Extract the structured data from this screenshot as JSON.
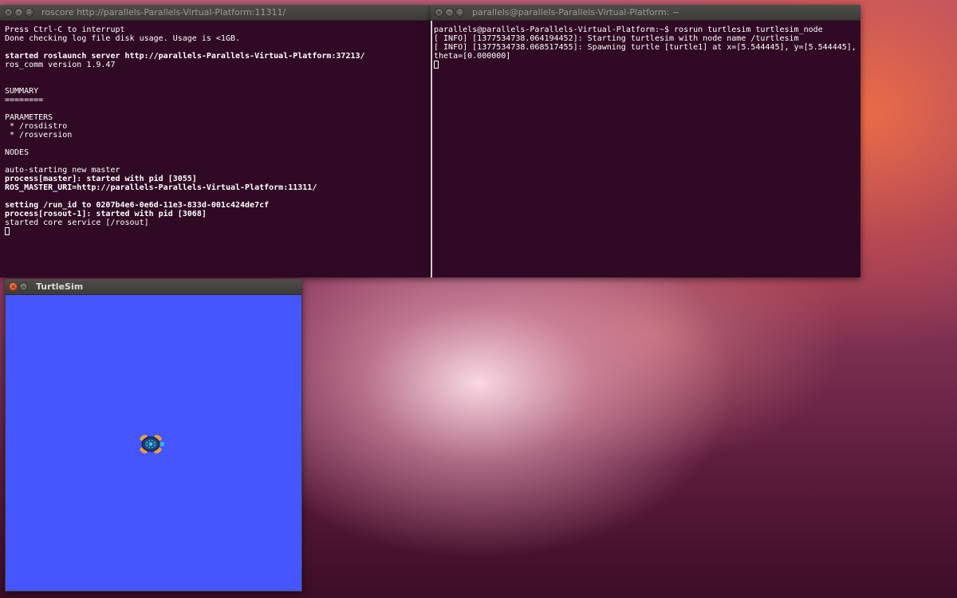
{
  "desktop": {
    "wallpaper": "ubuntu-default",
    "colors": {
      "pink": "#f3c6d6",
      "orange": "#e6603f",
      "aubergine": "#3c0d26"
    }
  },
  "windows": {
    "roscore_terminal": {
      "title": "roscore http://parallels-Parallels-Virtual-Platform:11311/",
      "lines": [
        {
          "text": "Press Ctrl-C to interrupt",
          "bold": false
        },
        {
          "text": "Done checking log file disk usage. Usage is <1GB.",
          "bold": false
        },
        {
          "text": "",
          "bold": false
        },
        {
          "text": "started roslaunch server http://parallels-Parallels-Virtual-Platform:37213/",
          "bold": true
        },
        {
          "text": "ros_comm version 1.9.47",
          "bold": false
        },
        {
          "text": "",
          "bold": false
        },
        {
          "text": "",
          "bold": false
        },
        {
          "text": "SUMMARY",
          "bold": false
        },
        {
          "text": "========",
          "bold": false
        },
        {
          "text": "",
          "bold": false
        },
        {
          "text": "PARAMETERS",
          "bold": false
        },
        {
          "text": " * /rosdistro",
          "bold": false
        },
        {
          "text": " * /rosversion",
          "bold": false
        },
        {
          "text": "",
          "bold": false
        },
        {
          "text": "NODES",
          "bold": false
        },
        {
          "text": "",
          "bold": false
        },
        {
          "text": "auto-starting new master",
          "bold": false
        },
        {
          "text": "process[master]: started with pid [3055]",
          "bold": true
        },
        {
          "text": "ROS_MASTER_URI=http://parallels-Parallels-Virtual-Platform:11311/",
          "bold": true
        },
        {
          "text": "",
          "bold": false
        },
        {
          "text": "setting /run_id to 0207b4e6-0e6d-11e3-833d-001c424de7cf",
          "bold": true
        },
        {
          "text": "process[rosout-1]: started with pid [3068]",
          "bold": true
        },
        {
          "text": "started core service [/rosout]",
          "bold": false
        }
      ]
    },
    "turtlesim_terminal": {
      "title": "parallels@parallels-Parallels-Virtual-Platform: ~",
      "lines": [
        "parallels@parallels-Parallels-Virtual-Platform:~$ rosrun turtlesim turtlesim_node",
        "[ INFO] [1377534738.064194452]: Starting turtlesim with node name /turtlesim",
        "[ INFO] [1377534738.068517455]: Spawning turtle [turtle1] at x=[5.544445], y=[5.544445], theta=[0.000000]"
      ]
    },
    "turtlesim_window": {
      "title": "TurtleSim",
      "background_color": "#4556ff",
      "turtle": {
        "name": "turtle1",
        "icon": "turtle-icon",
        "x": 5.544445,
        "y": 5.544445,
        "theta": 0.0
      }
    }
  }
}
